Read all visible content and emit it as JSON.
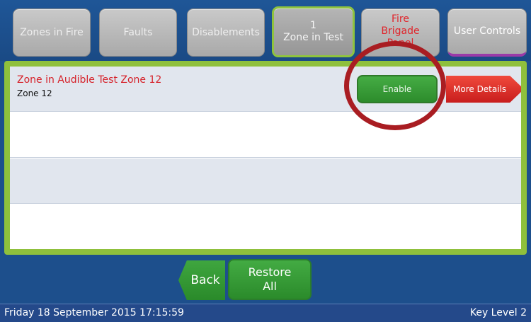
{
  "tabs": {
    "zones_in_fire": "Zones in Fire",
    "faults": "Faults",
    "disablements": "Disablements",
    "zone_in_test": "1\nZone in Test",
    "fire_brigade_panel": "Fire\nBrigade\nPanel",
    "user_controls": "User Controls"
  },
  "list": {
    "rows": [
      {
        "title": "Zone in Audible Test Zone 12",
        "subtitle": "Zone 12",
        "enable_label": "Enable",
        "more_label": "More Details"
      }
    ]
  },
  "buttons": {
    "back": "Back",
    "restore_all": "Restore\nAll"
  },
  "status": {
    "datetime": "Friday 18 September 2015 17:15:59",
    "key_level": "Key Level 2"
  },
  "colors": {
    "background_blue": "#1d4f8c",
    "panel_green": "#8fc03c",
    "alert_red": "#d6222a",
    "button_green": "#3a9e3a",
    "annotation_circle": "#a91d22"
  }
}
